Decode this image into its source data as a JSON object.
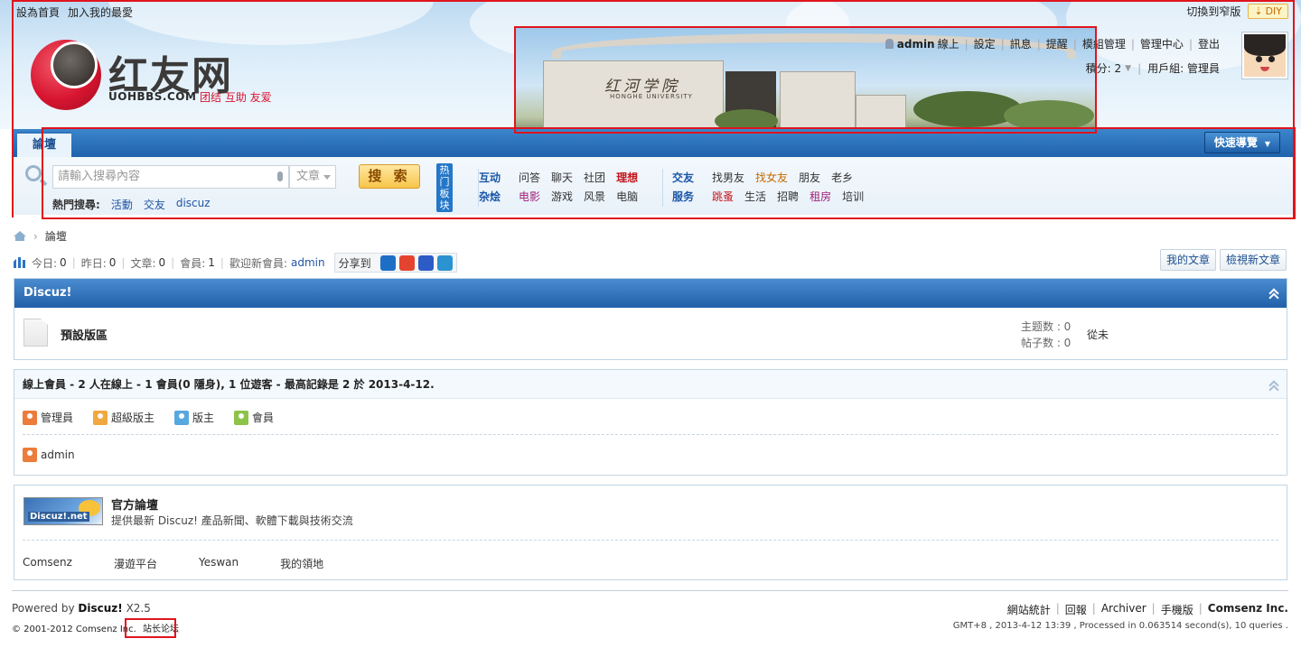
{
  "header": {
    "top_links": [
      "設為首頁",
      "加入我的最愛"
    ],
    "switch_label": "切換到窄版",
    "diy_label": "DIY",
    "logo": {
      "cn": "红友网",
      "en": "UOHBBS.COM",
      "slogan": "团结 互助 友爱"
    },
    "banner": {
      "sign": "红河学院",
      "sign_en": "HONGHE UNIVERSITY"
    },
    "user": {
      "name": "admin",
      "status": "線上",
      "links": [
        "設定",
        "訊息",
        "提醒",
        "模組管理",
        "管理中心",
        "登出"
      ],
      "points_label": "積分: 2",
      "group_label": "用戶組: 管理員"
    }
  },
  "nav": {
    "tab": "論壇",
    "quick_nav": "快速導覽"
  },
  "search": {
    "placeholder": "請輸入搜尋內容",
    "type": "文章",
    "button": "搜 索",
    "hot_label": "熱門搜尋:",
    "hot_terms": [
      "活動",
      "交友",
      "discuz"
    ]
  },
  "hot_board": {
    "label": "热门板块",
    "group1": [
      {
        "cat": "互动",
        "items": [
          "问答",
          "聊天",
          "社团",
          "理想"
        ]
      },
      {
        "cat": "杂烩",
        "items": [
          "电影",
          "游戏",
          "风景",
          "电脑"
        ]
      }
    ],
    "group2": [
      {
        "cat": "交友",
        "items": [
          "找男友",
          "找女友",
          "朋友",
          "老乡"
        ]
      },
      {
        "cat": "服务",
        "items": [
          "跳蚤",
          "生活",
          "招聘",
          "租房",
          "培训"
        ]
      }
    ]
  },
  "breadcrumb": {
    "current": "論壇"
  },
  "stats": {
    "today_label": "今日:",
    "today": "0",
    "yesterday_label": "昨日:",
    "yesterday": "0",
    "posts_label": "文章:",
    "posts": "0",
    "members_label": "會員:",
    "members": "1",
    "newest_label": "歡迎新會員:",
    "newest": "admin",
    "share_label": "分享到"
  },
  "actions": {
    "my_posts": "我的文章",
    "new_posts": "檢視新文章"
  },
  "category": {
    "title": "Discuz!",
    "forum": {
      "name": "預設版區",
      "threads_label": "主题数 : 0",
      "posts_label": "帖子数 : 0",
      "last": "從未"
    }
  },
  "online": {
    "title": "線上會員 - 2 人在線上 - 1 會員(0 隱身), 1 位遊客 - 最高記錄是 2 於 2013-4-12.",
    "legend": [
      "管理員",
      "超級版主",
      "版主",
      "會員"
    ],
    "users": [
      "admin"
    ]
  },
  "official": {
    "logo_text": "Discuz!.net",
    "title": "官方論壇",
    "desc": "提供最新 Discuz! 產品新聞、軟體下載與技術交流",
    "links": [
      "Comsenz",
      "漫遊平台",
      "Yeswan",
      "我的領地"
    ]
  },
  "footer": {
    "powered_prefix": "Powered by",
    "powered_name": "Discuz!",
    "powered_ver": "X2.5",
    "copyright": "© 2001-2012 Comsenz Inc.",
    "admin_link": "站长论坛",
    "links": [
      "網站統計",
      "回報",
      "Archiver",
      "手機版",
      "Comsenz Inc."
    ],
    "info": "GMT+8 , 2013-4-12 13:39 , Processed in 0.063514 second(s), 10 queries ."
  },
  "colors": {
    "accent": "#2160a9",
    "highlight_frame": "#e0141d"
  }
}
